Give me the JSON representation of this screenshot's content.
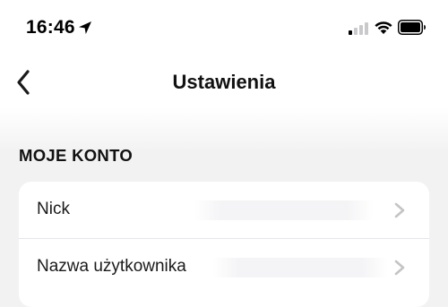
{
  "status_bar": {
    "time": "16:46",
    "icons": [
      "location-arrow-icon",
      "cellular-signal-icon",
      "wifi-icon",
      "battery-icon"
    ]
  },
  "nav": {
    "back_icon": "chevron-left-icon",
    "title": "Ustawienia"
  },
  "section": {
    "header": "MOJE KONTO",
    "rows": [
      {
        "label": "Nick",
        "value": ""
      },
      {
        "label": "Nazwa użytkownika",
        "value": ""
      }
    ]
  },
  "colors": {
    "background": "#f2f2f3",
    "card": "#ffffff",
    "text": "#111111",
    "chevron": "#c4c4c7",
    "divider": "#e6e6e8"
  }
}
